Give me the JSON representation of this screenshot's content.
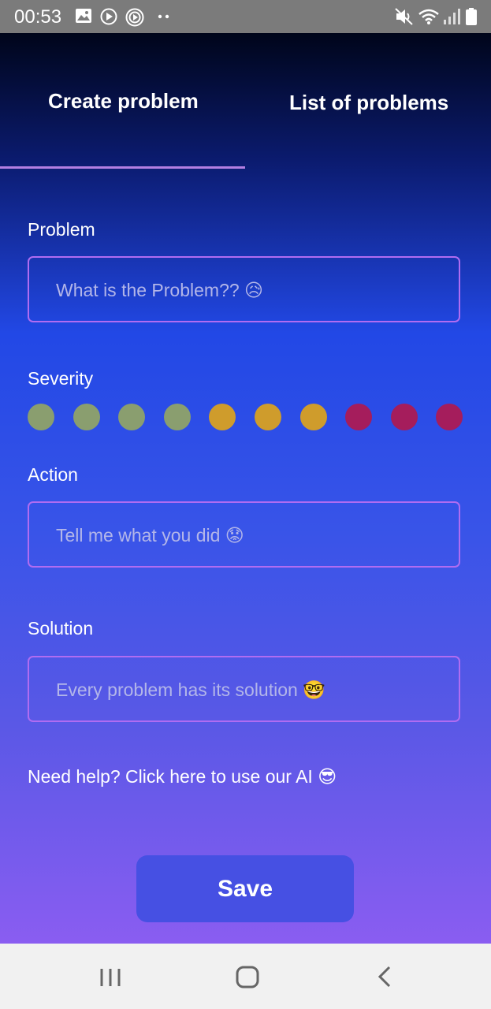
{
  "status_bar": {
    "time": "00:53",
    "left_icons": [
      "image-icon",
      "play-icon",
      "radio-icon",
      "more-dots-icon"
    ],
    "right_icons": [
      "mute-icon",
      "wifi-icon",
      "signal-icon",
      "battery-icon"
    ]
  },
  "tabs": [
    {
      "label": "Create problem",
      "active": true
    },
    {
      "label": "List of problems",
      "active": false
    }
  ],
  "form": {
    "problem": {
      "label": "Problem",
      "placeholder": "What is the Problem?? 😥",
      "value": ""
    },
    "severity": {
      "label": "Severity",
      "levels": [
        {
          "color": "#8a9e6f"
        },
        {
          "color": "#8a9e6f"
        },
        {
          "color": "#8a9e6f"
        },
        {
          "color": "#8a9e6f"
        },
        {
          "color": "#cf9c2c"
        },
        {
          "color": "#cf9c2c"
        },
        {
          "color": "#cf9c2c"
        },
        {
          "color": "#a51d5c"
        },
        {
          "color": "#a51d5c"
        },
        {
          "color": "#a51d5c"
        }
      ]
    },
    "action": {
      "label": "Action",
      "placeholder": "Tell me what you did 😟",
      "value": ""
    },
    "solution": {
      "label": "Solution",
      "placeholder": "Every problem has its solution 🤓",
      "value": ""
    }
  },
  "help_link": "Need help? Click here to use our AI 😎",
  "save_label": "Save",
  "nav_bar": [
    "recent-apps-icon",
    "home-icon",
    "back-icon"
  ],
  "colors": {
    "accent_border": "#b06cf1",
    "tab_indicator": "#b37fe2",
    "save_button": "#4650e3"
  }
}
